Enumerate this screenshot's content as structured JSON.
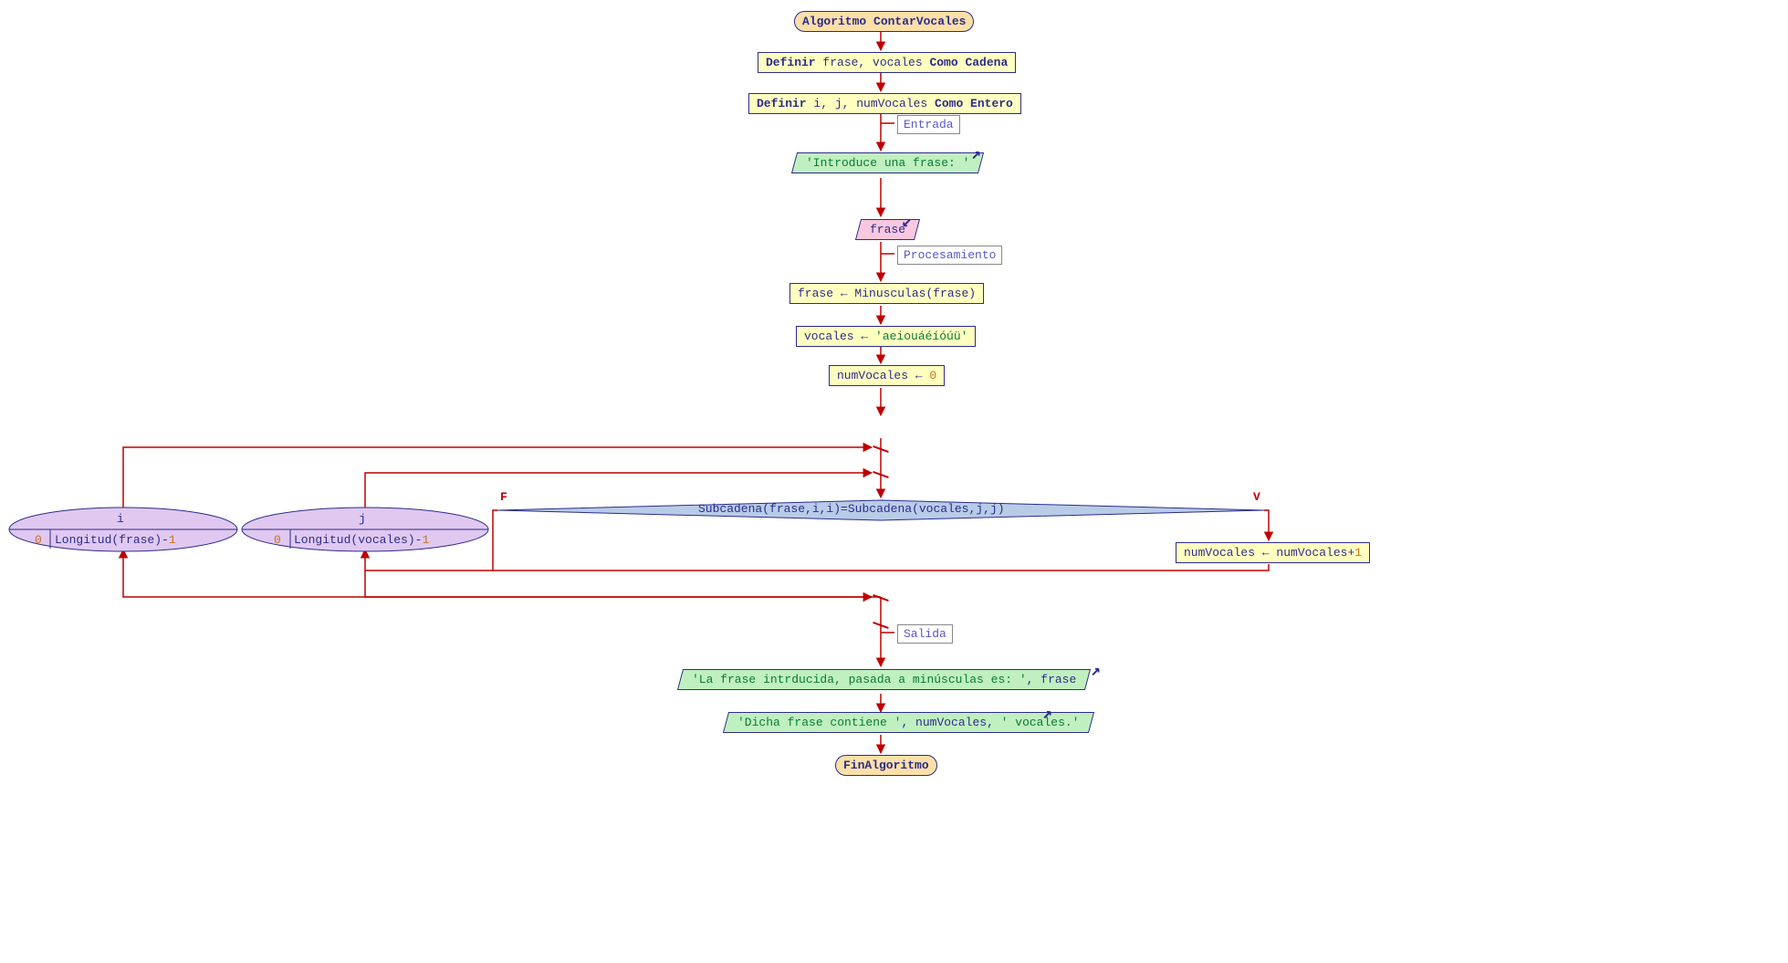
{
  "terminal_start": "Algoritmo ContarVocales",
  "decl1": {
    "kw": "Definir",
    "vars": " frase, vocales ",
    "kw2": "Como Cadena"
  },
  "decl2": {
    "kw": "Definir",
    "vars": " i, j, numVocales ",
    "kw2": "Como Entero"
  },
  "label_entrada": "Entrada",
  "output_prompt": "'Introduce una frase: '",
  "input_var": "frase",
  "label_proc": "Procesamiento",
  "proc1": {
    "lhs": "frase",
    "op": " ← ",
    "fn": "Minusculas",
    "arg": "(frase)"
  },
  "proc2": {
    "lhs": "vocales",
    "op": " ← ",
    "str": "'aeiouáéíóúü'"
  },
  "proc3": {
    "lhs": "numVocales",
    "op": " ← ",
    "num": "0"
  },
  "decision": {
    "fn1": "Subcadena",
    "a1": "(frase,i,i)",
    "eq": "=",
    "fn2": "Subcadena",
    "a2": "(vocales,j,j)"
  },
  "dec_false": "F",
  "dec_true": "V",
  "proc4": {
    "lhs": "numVocales",
    "op": " ← ",
    "rhs": "numVocales",
    "plus": "+",
    "num": "1"
  },
  "loop1": {
    "var": "i",
    "from": "0",
    "fn": "Longitud",
    "arg": "(frase)",
    "minus": "-",
    "num": "1"
  },
  "loop2": {
    "var": "j",
    "from": "0",
    "fn": "Longitud",
    "arg": "(vocales)",
    "minus": "-",
    "num": "1"
  },
  "label_salida": "Salida",
  "out1": {
    "s1": "'La frase intrducida, pasada a minúsculas es: '",
    "c": ", ",
    "v": "frase"
  },
  "out2": {
    "s1": "'Dicha frase contiene '",
    "c1": ", ",
    "v": "numVocales",
    "c2": ", ",
    "s2": "' vocales.'"
  },
  "terminal_end": "FinAlgoritmo"
}
